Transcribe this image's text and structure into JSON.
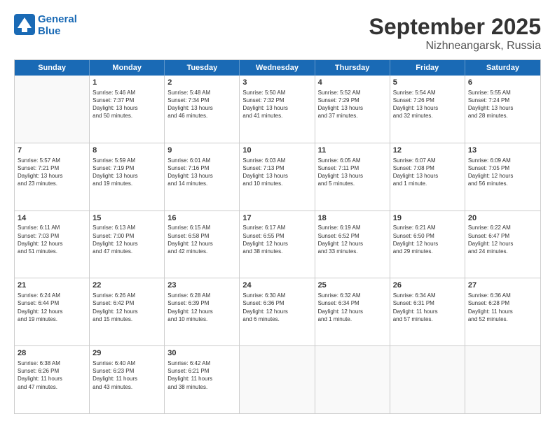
{
  "header": {
    "logo_line1": "General",
    "logo_line2": "Blue",
    "main_title": "September 2025",
    "sub_title": "Nizhneangarsk, Russia"
  },
  "days_of_week": [
    "Sunday",
    "Monday",
    "Tuesday",
    "Wednesday",
    "Thursday",
    "Friday",
    "Saturday"
  ],
  "weeks": [
    [
      {
        "day": "",
        "info": ""
      },
      {
        "day": "1",
        "info": "Sunrise: 5:46 AM\nSunset: 7:37 PM\nDaylight: 13 hours\nand 50 minutes."
      },
      {
        "day": "2",
        "info": "Sunrise: 5:48 AM\nSunset: 7:34 PM\nDaylight: 13 hours\nand 46 minutes."
      },
      {
        "day": "3",
        "info": "Sunrise: 5:50 AM\nSunset: 7:32 PM\nDaylight: 13 hours\nand 41 minutes."
      },
      {
        "day": "4",
        "info": "Sunrise: 5:52 AM\nSunset: 7:29 PM\nDaylight: 13 hours\nand 37 minutes."
      },
      {
        "day": "5",
        "info": "Sunrise: 5:54 AM\nSunset: 7:26 PM\nDaylight: 13 hours\nand 32 minutes."
      },
      {
        "day": "6",
        "info": "Sunrise: 5:55 AM\nSunset: 7:24 PM\nDaylight: 13 hours\nand 28 minutes."
      }
    ],
    [
      {
        "day": "7",
        "info": "Sunrise: 5:57 AM\nSunset: 7:21 PM\nDaylight: 13 hours\nand 23 minutes."
      },
      {
        "day": "8",
        "info": "Sunrise: 5:59 AM\nSunset: 7:19 PM\nDaylight: 13 hours\nand 19 minutes."
      },
      {
        "day": "9",
        "info": "Sunrise: 6:01 AM\nSunset: 7:16 PM\nDaylight: 13 hours\nand 14 minutes."
      },
      {
        "day": "10",
        "info": "Sunrise: 6:03 AM\nSunset: 7:13 PM\nDaylight: 13 hours\nand 10 minutes."
      },
      {
        "day": "11",
        "info": "Sunrise: 6:05 AM\nSunset: 7:11 PM\nDaylight: 13 hours\nand 5 minutes."
      },
      {
        "day": "12",
        "info": "Sunrise: 6:07 AM\nSunset: 7:08 PM\nDaylight: 13 hours\nand 1 minute."
      },
      {
        "day": "13",
        "info": "Sunrise: 6:09 AM\nSunset: 7:05 PM\nDaylight: 12 hours\nand 56 minutes."
      }
    ],
    [
      {
        "day": "14",
        "info": "Sunrise: 6:11 AM\nSunset: 7:03 PM\nDaylight: 12 hours\nand 51 minutes."
      },
      {
        "day": "15",
        "info": "Sunrise: 6:13 AM\nSunset: 7:00 PM\nDaylight: 12 hours\nand 47 minutes."
      },
      {
        "day": "16",
        "info": "Sunrise: 6:15 AM\nSunset: 6:58 PM\nDaylight: 12 hours\nand 42 minutes."
      },
      {
        "day": "17",
        "info": "Sunrise: 6:17 AM\nSunset: 6:55 PM\nDaylight: 12 hours\nand 38 minutes."
      },
      {
        "day": "18",
        "info": "Sunrise: 6:19 AM\nSunset: 6:52 PM\nDaylight: 12 hours\nand 33 minutes."
      },
      {
        "day": "19",
        "info": "Sunrise: 6:21 AM\nSunset: 6:50 PM\nDaylight: 12 hours\nand 29 minutes."
      },
      {
        "day": "20",
        "info": "Sunrise: 6:22 AM\nSunset: 6:47 PM\nDaylight: 12 hours\nand 24 minutes."
      }
    ],
    [
      {
        "day": "21",
        "info": "Sunrise: 6:24 AM\nSunset: 6:44 PM\nDaylight: 12 hours\nand 19 minutes."
      },
      {
        "day": "22",
        "info": "Sunrise: 6:26 AM\nSunset: 6:42 PM\nDaylight: 12 hours\nand 15 minutes."
      },
      {
        "day": "23",
        "info": "Sunrise: 6:28 AM\nSunset: 6:39 PM\nDaylight: 12 hours\nand 10 minutes."
      },
      {
        "day": "24",
        "info": "Sunrise: 6:30 AM\nSunset: 6:36 PM\nDaylight: 12 hours\nand 6 minutes."
      },
      {
        "day": "25",
        "info": "Sunrise: 6:32 AM\nSunset: 6:34 PM\nDaylight: 12 hours\nand 1 minute."
      },
      {
        "day": "26",
        "info": "Sunrise: 6:34 AM\nSunset: 6:31 PM\nDaylight: 11 hours\nand 57 minutes."
      },
      {
        "day": "27",
        "info": "Sunrise: 6:36 AM\nSunset: 6:28 PM\nDaylight: 11 hours\nand 52 minutes."
      }
    ],
    [
      {
        "day": "28",
        "info": "Sunrise: 6:38 AM\nSunset: 6:26 PM\nDaylight: 11 hours\nand 47 minutes."
      },
      {
        "day": "29",
        "info": "Sunrise: 6:40 AM\nSunset: 6:23 PM\nDaylight: 11 hours\nand 43 minutes."
      },
      {
        "day": "30",
        "info": "Sunrise: 6:42 AM\nSunset: 6:21 PM\nDaylight: 11 hours\nand 38 minutes."
      },
      {
        "day": "",
        "info": ""
      },
      {
        "day": "",
        "info": ""
      },
      {
        "day": "",
        "info": ""
      },
      {
        "day": "",
        "info": ""
      }
    ]
  ]
}
